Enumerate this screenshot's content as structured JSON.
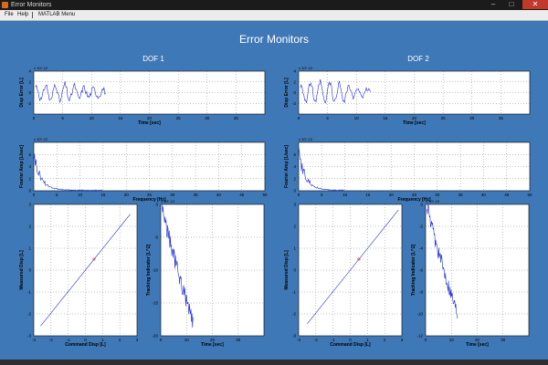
{
  "window": {
    "title": "Error Monitors",
    "controls": [
      "–",
      "□",
      "✕"
    ]
  },
  "menu": {
    "items": [
      "File",
      "Help",
      "MATLAB Menu"
    ]
  },
  "figure": {
    "title": "Error Monitors",
    "background": "#3f78b6",
    "dofs": [
      {
        "title": "DOF 1"
      },
      {
        "title": "DOF 2"
      }
    ]
  },
  "chart_data": [
    {
      "type": "line",
      "panel": "DOF 1",
      "xlabel": "Time [sec]",
      "ylabel": "Disp Error [L]",
      "exponent": "x 10^-12",
      "xlim": [
        0,
        40
      ],
      "ylim": [
        -4,
        4
      ],
      "xticks": [
        "0",
        "5",
        "10",
        "15",
        "20",
        "25",
        "30",
        "35"
      ],
      "yticks": [
        "-2",
        "0",
        "2",
        "4"
      ],
      "series": [
        {
          "x_end": 12.5,
          "values": "oscillating +/-2"
        }
      ]
    },
    {
      "type": "line",
      "panel": "DOF 1",
      "xlabel": "Frequency [Hz]",
      "ylabel": "Fourier Amp [L/sec]",
      "exponent": "x 10^-12",
      "xlim": [
        0,
        50
      ],
      "ylim": [
        0,
        8
      ],
      "xticks": [
        "0",
        "5",
        "10",
        "15",
        "20",
        "25",
        "30",
        "35",
        "40",
        "45",
        "50"
      ],
      "yticks": [
        "0",
        "2",
        "4",
        "6"
      ]
    },
    {
      "type": "line",
      "panel": "DOF 1",
      "xlabel": "Command Disp [L]",
      "ylabel": "Measured Disp [L]",
      "xlim": [
        -3,
        3
      ],
      "ylim": [
        -3,
        3
      ],
      "xticks": [
        "-3",
        "-2",
        "-1",
        "0",
        "1",
        "2",
        "3"
      ],
      "yticks": [
        "-3",
        "-2",
        "-1",
        "0",
        "1",
        "2",
        "3"
      ]
    },
    {
      "type": "line",
      "panel": "DOF 1",
      "xlabel": "Time [sec]",
      "ylabel": "Tracking Indicator [L^2]",
      "exponent": "x 10^-12",
      "xlim": [
        0,
        40
      ],
      "ylim": [
        -20,
        0
      ],
      "xticks": [
        "0",
        "10",
        "20",
        "30"
      ],
      "yticks": [
        "-20",
        "-15",
        "-10",
        "-5",
        "0"
      ]
    },
    {
      "type": "line",
      "panel": "DOF 2",
      "xlabel": "Time [sec]",
      "ylabel": "Disp Error [L]",
      "exponent": "x 10^-12",
      "xlim": [
        0,
        40
      ],
      "ylim": [
        -4,
        4
      ],
      "xticks": [
        "0",
        "5",
        "10",
        "15",
        "20",
        "25",
        "30",
        "35"
      ],
      "yticks": [
        "-2",
        "0",
        "2",
        "4"
      ]
    },
    {
      "type": "line",
      "panel": "DOF 2",
      "xlabel": "Frequency [Hz]",
      "ylabel": "Fourier Amp [L/sec]",
      "exponent": "x 10^-12",
      "xlim": [
        0,
        50
      ],
      "ylim": [
        0,
        8
      ],
      "xticks": [
        "0",
        "5",
        "10",
        "15",
        "20",
        "25",
        "30",
        "35",
        "40",
        "45",
        "50"
      ],
      "yticks": [
        "0",
        "2",
        "4",
        "6"
      ]
    },
    {
      "type": "line",
      "panel": "DOF 2",
      "xlabel": "Command Disp [L]",
      "ylabel": "Measured Disp [L]",
      "xlim": [
        -3,
        3
      ],
      "ylim": [
        -3,
        3
      ],
      "xticks": [
        "-3",
        "-2",
        "-1",
        "0",
        "1",
        "2",
        "3"
      ],
      "yticks": [
        "-3",
        "-2",
        "-1",
        "0",
        "1",
        "2",
        "3"
      ]
    },
    {
      "type": "line",
      "panel": "DOF 2",
      "xlabel": "Time [sec]",
      "ylabel": "Tracking Indicator [L^2]",
      "exponent": "x 10^-12",
      "xlim": [
        0,
        40
      ],
      "ylim": [
        -12,
        0
      ],
      "xticks": [
        "0",
        "10",
        "20",
        "30"
      ],
      "yticks": [
        "-12",
        "-10",
        "-8",
        "-6",
        "-4",
        "-2",
        "0"
      ]
    }
  ]
}
